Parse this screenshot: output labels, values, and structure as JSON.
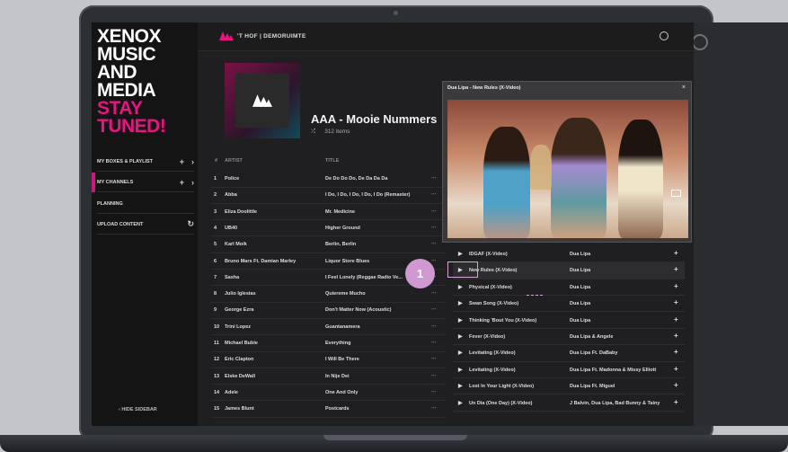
{
  "sidebar": {
    "brand_line1": "XENOX",
    "brand_line2": "MUSIC",
    "brand_line3": "AND",
    "brand_line4": "MEDIA",
    "brand_line5": "STAY",
    "brand_line6": "TUNED!",
    "items": [
      {
        "label": "MY BOXES & PLAYLIST"
      },
      {
        "label": "MY CHANNELS"
      },
      {
        "label": "PLANNING"
      },
      {
        "label": "UPLOAD CONTENT"
      }
    ],
    "hide_label": "‹  HIDE SIDEBAR"
  },
  "header": {
    "title": "'T HOF | DEMORUIMTE"
  },
  "playlist": {
    "title": "AAA - Mooie Nummers",
    "count": "312 items"
  },
  "table": {
    "columns": {
      "num": "#",
      "artist": "ARTIST",
      "title": "TITLE"
    },
    "rows": [
      {
        "num": "1",
        "artist": "Police",
        "title": "De Do Do Do, De Da Da Da"
      },
      {
        "num": "2",
        "artist": "Abba",
        "title": "I Do, I Do, I Do, I Do, I Do (Remaster)"
      },
      {
        "num": "3",
        "artist": "Eliza Doolittle",
        "title": "Mr. Medicine"
      },
      {
        "num": "4",
        "artist": "UB40",
        "title": "Higher Ground"
      },
      {
        "num": "5",
        "artist": "Karl Moik",
        "title": "Berlin, Berlin"
      },
      {
        "num": "6",
        "artist": "Bruno Mars Ft. Damian Marley",
        "title": "Liquor Store Blues"
      },
      {
        "num": "7",
        "artist": "Saxha",
        "title": "I Feel Lonely (Reggae Radio Ve..."
      },
      {
        "num": "8",
        "artist": "Julio Iglesias",
        "title": "Quiereme Mucho"
      },
      {
        "num": "9",
        "artist": "George Ezra",
        "title": "Don't Matter Now (Acoustic)"
      },
      {
        "num": "10",
        "artist": "Trini Lopez",
        "title": "Guantanamera"
      },
      {
        "num": "11",
        "artist": "Michael Buble",
        "title": "Everything"
      },
      {
        "num": "12",
        "artist": "Eric Clapton",
        "title": "I Will Be There"
      },
      {
        "num": "13",
        "artist": "Elske DeWall",
        "title": "In Nije Dei"
      },
      {
        "num": "14",
        "artist": "Adele",
        "title": "One And Only"
      },
      {
        "num": "15",
        "artist": "James Blunt",
        "title": "Postcards"
      }
    ],
    "more_glyph": "⋯"
  },
  "video_popup": {
    "title": "Dua Lipa - New Rules (X-Video)",
    "close": "×"
  },
  "video_list": [
    {
      "title": "IDGAF (X-Video)",
      "artist": "Dua Lipa"
    },
    {
      "title": "New Rules (X-Video)",
      "artist": "Dua Lipa"
    },
    {
      "title": "Physical (X-Video)",
      "artist": "Dua Lipa"
    },
    {
      "title": "Swan Song (X-Video)",
      "artist": "Dua Lipa"
    },
    {
      "title": "Thinking 'Bout You (X-Video)",
      "artist": "Dua Lipa"
    },
    {
      "title": "Fever (X-Video)",
      "artist": "Dua Lipa & Angele"
    },
    {
      "title": "Levitating (X-Video)",
      "artist": "Dua Lipa Ft. DaBaby"
    },
    {
      "title": "Levitating (X-Video)",
      "artist": "Dua Lipa Ft. Madonna & Missy Elliott"
    },
    {
      "title": "Lost In Your Light (X-Video)",
      "artist": "Dua Lipa Ft. Miguel"
    },
    {
      "title": "Un Dia (One Day) (X-Video)",
      "artist": "J Balvin, Dua Lipa, Bad Bunny & Tainy"
    }
  ],
  "callout_number": "1",
  "colors": {
    "accent": "#e6157f",
    "callout": "#d098d0"
  }
}
